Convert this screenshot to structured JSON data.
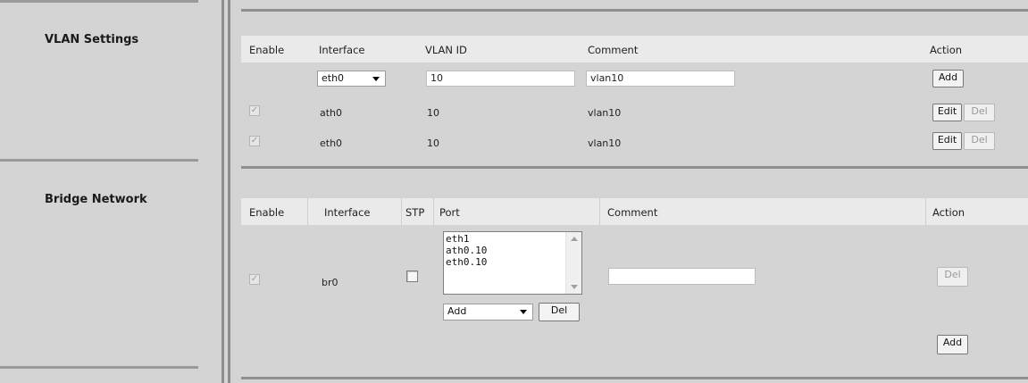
{
  "sections": {
    "vlan_title": "VLAN Settings",
    "bridge_title": "Bridge Network"
  },
  "vlan": {
    "headers": {
      "enable": "Enable",
      "interface": "Interface",
      "vlan_id": "VLAN ID",
      "comment": "Comment",
      "action": "Action"
    },
    "new_row": {
      "interface": "eth0",
      "vlan_id": "10",
      "comment": "vlan10",
      "add_label": "Add"
    },
    "rows": [
      {
        "enabled": true,
        "interface": "ath0",
        "vlan_id": "10",
        "comment": "vlan10",
        "edit_label": "Edit",
        "del_label": "Del"
      },
      {
        "enabled": true,
        "interface": "eth0",
        "vlan_id": "10",
        "comment": "vlan10",
        "edit_label": "Edit",
        "del_label": "Del"
      }
    ]
  },
  "bridge": {
    "headers": {
      "enable": "Enable",
      "interface": "Interface",
      "stp": "STP",
      "port": "Port",
      "comment": "Comment",
      "action": "Action"
    },
    "rows": [
      {
        "enabled": true,
        "interface": "br0",
        "stp": false,
        "ports": [
          "eth1",
          "ath0.10",
          "eth0.10"
        ],
        "port_add_select": "Add",
        "port_del_label": "Del",
        "comment": "",
        "del_label": "Del"
      }
    ],
    "add_label": "Add"
  },
  "colors": {
    "background": "#d4d4d4",
    "header_row": "#eaeaea",
    "separator": "#8e8e8e"
  }
}
